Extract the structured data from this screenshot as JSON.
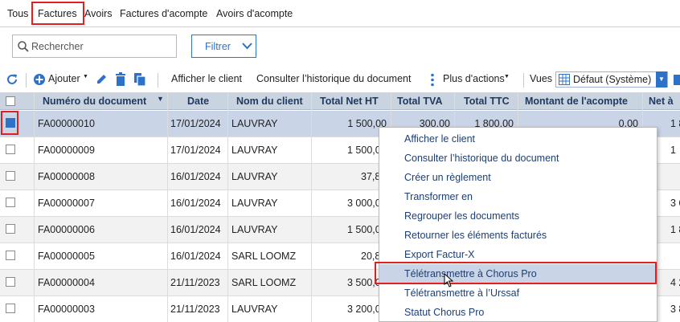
{
  "tabs": [
    "Tous",
    "Factures",
    "Avoirs",
    "Factures d'acompte",
    "Avoirs d'acompte"
  ],
  "search": {
    "placeholder": "Rechercher"
  },
  "filter": {
    "label": "Filtrer"
  },
  "toolbar": {
    "add_label": "Ajouter",
    "show_client": "Afficher le client",
    "history": "Consulter l’historique du document",
    "more_actions": "Plus d'actions",
    "views_label": "Vues",
    "view_value": "Défaut (Système)"
  },
  "columns": [
    "Numéro du document",
    "Date",
    "Nom du client",
    "Total Net HT",
    "Total TVA",
    "Total TTC",
    "Montant de l'acompte",
    "Net à"
  ],
  "rows": [
    {
      "num": "FA00000010",
      "date": "17/01/2024",
      "client": "LAUVRAY",
      "ht": "1 500,00",
      "tva": "300,00",
      "ttc": "1 800,00",
      "acompte": "0,00",
      "net": "1 8",
      "checked": true
    },
    {
      "num": "FA00000009",
      "date": "17/01/2024",
      "client": "LAUVRAY",
      "ht": "1 500,0",
      "tva": "",
      "ttc": "",
      "acompte": "",
      "net": "1",
      "checked": false
    },
    {
      "num": "FA00000008",
      "date": "16/01/2024",
      "client": "LAUVRAY",
      "ht": "37,8",
      "tva": "",
      "ttc": "",
      "acompte": "",
      "net": "",
      "checked": false
    },
    {
      "num": "FA00000007",
      "date": "16/01/2024",
      "client": "LAUVRAY",
      "ht": "3 000,0",
      "tva": "",
      "ttc": "",
      "acompte": "",
      "net": "3 6",
      "checked": false
    },
    {
      "num": "FA00000006",
      "date": "16/01/2024",
      "client": "LAUVRAY",
      "ht": "1 500,0",
      "tva": "",
      "ttc": "",
      "acompte": "",
      "net": "1 8",
      "checked": false
    },
    {
      "num": "FA00000005",
      "date": "16/01/2024",
      "client": "SARL LOOMZ",
      "ht": "20,8",
      "tva": "",
      "ttc": "",
      "acompte": "",
      "net": "",
      "checked": false
    },
    {
      "num": "FA00000004",
      "date": "21/11/2023",
      "client": "SARL LOOMZ",
      "ht": "3 500,0",
      "tva": "",
      "ttc": "",
      "acompte": "",
      "net": "4 2",
      "checked": false
    },
    {
      "num": "FA00000003",
      "date": "21/11/2023",
      "client": "LAUVRAY",
      "ht": "3 200,0",
      "tva": "",
      "ttc": "",
      "acompte": "",
      "net": "3 8",
      "checked": false
    }
  ],
  "context_menu": [
    "Afficher le client",
    "Consulter l’historique du document",
    "Créer un règlement",
    "Transformer en",
    "Regrouper les documents",
    "Retourner les éléments facturés",
    "Export Factur-X",
    "Télétransmettre à Chorus Pro",
    "Télétransmettre à l’Urssaf",
    "Statut Chorus Pro"
  ],
  "colors": {
    "accent": "#2b72c8",
    "header_bg": "#cad3e0",
    "selected_row": "#c9d4e6",
    "highlight": "#e02020",
    "menu_text": "#1e3f70"
  }
}
